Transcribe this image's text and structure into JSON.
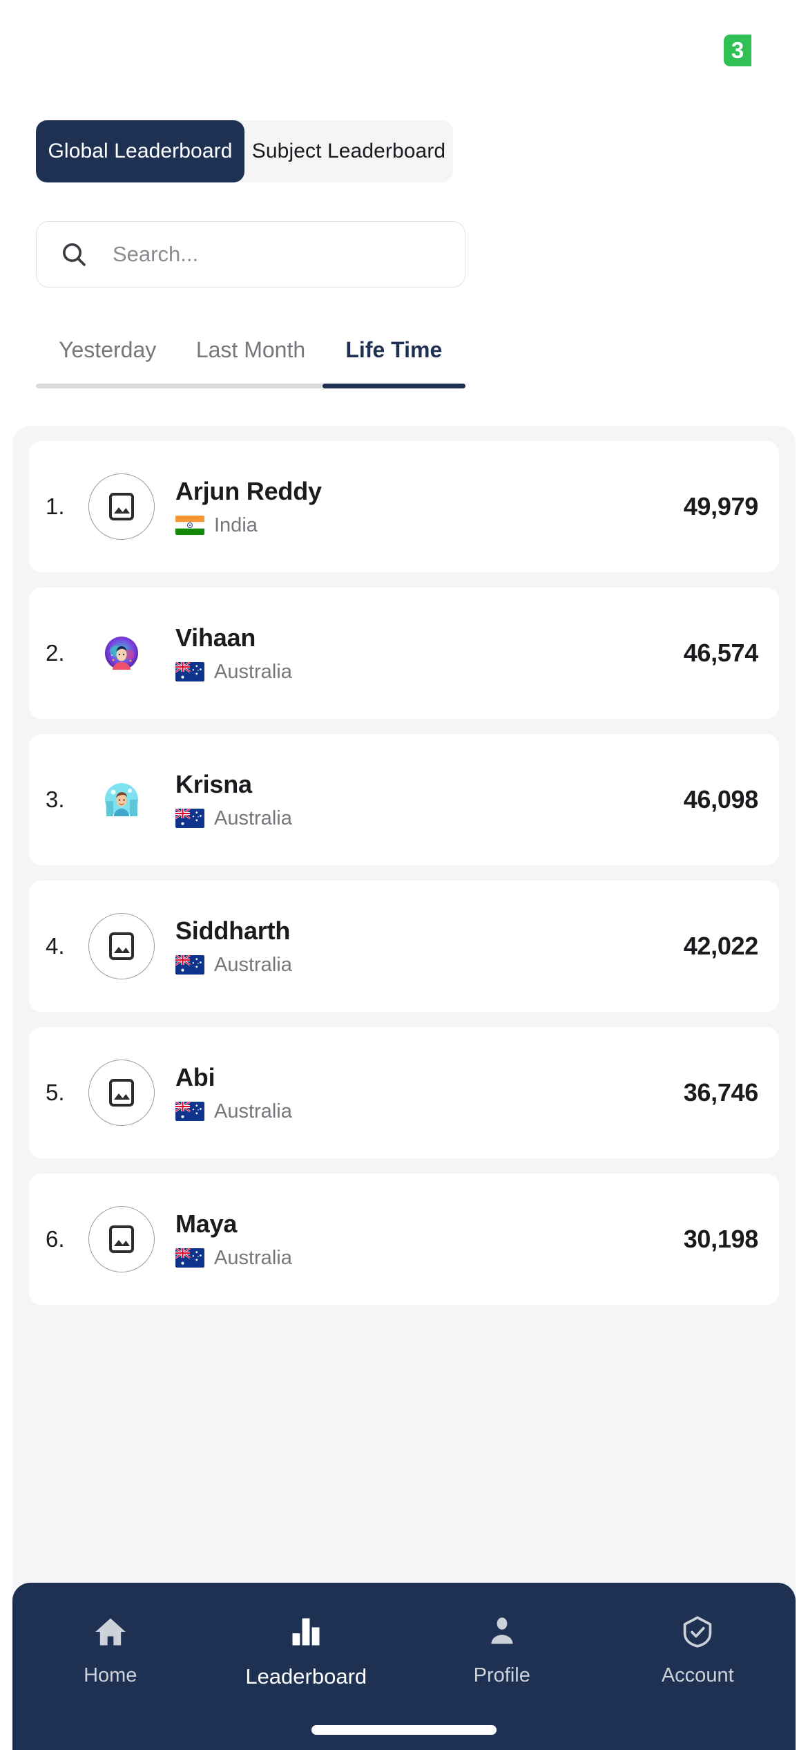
{
  "status": {
    "badge_count": "3"
  },
  "segmented": {
    "options": [
      {
        "label": "Global Leaderboard",
        "active": true
      },
      {
        "label": "Subject Leaderboard",
        "active": false
      }
    ]
  },
  "search": {
    "value": "",
    "placeholder": "Search...",
    "icon": "search-icon"
  },
  "period_tabs": {
    "items": [
      {
        "label": "Yesterday",
        "active": false
      },
      {
        "label": "Last Month",
        "active": false
      },
      {
        "label": "Life Time",
        "active": true
      }
    ],
    "active_index": 2
  },
  "leaderboard": {
    "rows": [
      {
        "rank": "1.",
        "name": "Arjun Reddy",
        "country": "India",
        "flag": "in",
        "score": "49,979",
        "avatar": "placeholder"
      },
      {
        "rank": "2.",
        "name": "Vihaan",
        "country": "Australia",
        "flag": "au",
        "score": "46,574",
        "avatar": "illustration-cosmic"
      },
      {
        "rank": "3.",
        "name": "Krisna",
        "country": "Australia",
        "flag": "au",
        "score": "46,098",
        "avatar": "illustration-city"
      },
      {
        "rank": "4.",
        "name": "Siddharth",
        "country": "Australia",
        "flag": "au",
        "score": "42,022",
        "avatar": "placeholder"
      },
      {
        "rank": "5.",
        "name": "Abi",
        "country": "Australia",
        "flag": "au",
        "score": "36,746",
        "avatar": "placeholder"
      },
      {
        "rank": "6.",
        "name": "Maya",
        "country": "Australia",
        "flag": "au",
        "score": "30,198",
        "avatar": "placeholder"
      }
    ]
  },
  "bottom_nav": {
    "items": [
      {
        "label": "Home",
        "icon": "home-icon",
        "active": false
      },
      {
        "label": "Leaderboard",
        "icon": "bar-chart-icon",
        "active": true
      },
      {
        "label": "Profile",
        "icon": "person-icon",
        "active": false
      },
      {
        "label": "Account",
        "icon": "shield-check-icon",
        "active": false
      }
    ]
  },
  "colors": {
    "navy": "#1e3152",
    "badge_green": "#2fc156",
    "panel_grey": "#f5f5f7",
    "muted_text": "#76767c"
  }
}
